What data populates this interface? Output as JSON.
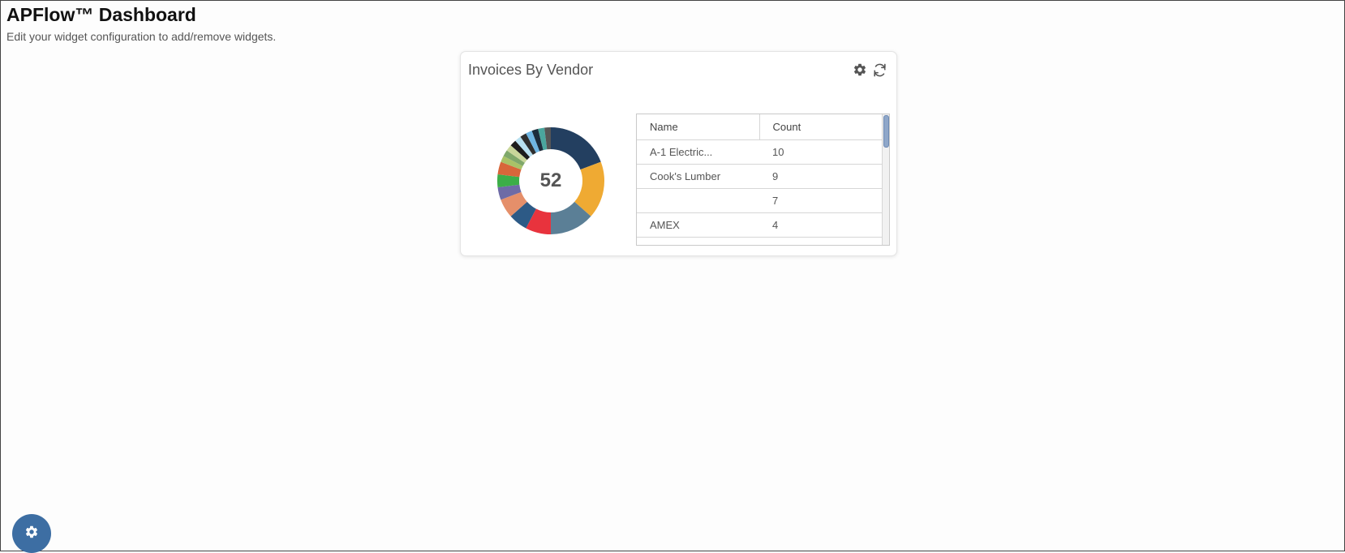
{
  "page": {
    "title": "APFlow™ Dashboard",
    "subtitle": "Edit your widget configuration to add/remove widgets."
  },
  "widget": {
    "title": "Invoices By Vendor",
    "tools": [
      "gear-icon",
      "refresh-icon"
    ],
    "total": "52",
    "table": {
      "headers": [
        "Name",
        "Count"
      ],
      "rows": [
        {
          "name": "A-1 Electric...",
          "count": "10"
        },
        {
          "name": "Cook's Lumber",
          "count": "9"
        },
        {
          "name": "",
          "count": "7"
        },
        {
          "name": "AMEX",
          "count": "4"
        }
      ]
    }
  },
  "chart_data": {
    "type": "pie",
    "total": 52,
    "values": [
      10,
      9,
      7,
      4,
      3,
      3,
      2,
      2,
      2,
      1,
      1,
      1,
      1,
      1,
      1,
      1,
      1,
      1,
      1
    ],
    "colors": [
      "#233f60",
      "#efaa33",
      "#5b7f96",
      "#e8333d",
      "#2d5a86",
      "#e58f6a",
      "#6e6ba6",
      "#3cae48",
      "#d8663a",
      "#a9c267",
      "#7fa86a",
      "#c8d69a",
      "#1c1c1c",
      "#b8e0f0",
      "#2f2f2f",
      "#6fb6e3",
      "#1c2c3c",
      "#4aa59d",
      "#565656"
    ]
  },
  "footer": {
    "fab_icon": "gear-icon"
  },
  "colors": {
    "fab": "#3d6ea3",
    "accent": "#233f60"
  }
}
